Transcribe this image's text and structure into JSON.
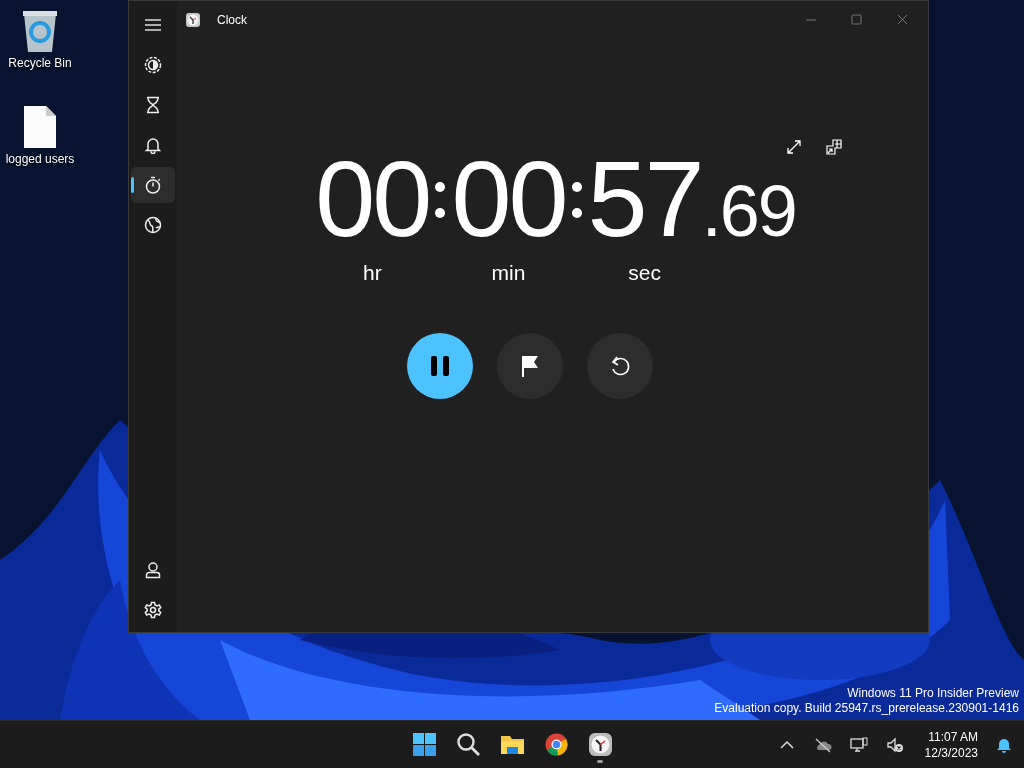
{
  "desktop_icons": [
    {
      "kind": "recycle",
      "label": "Recycle Bin"
    },
    {
      "kind": "file",
      "label": "logged users"
    }
  ],
  "window": {
    "title": "Clock"
  },
  "nav_items": [
    {
      "kind": "focus",
      "selected": false
    },
    {
      "kind": "timer",
      "selected": false
    },
    {
      "kind": "alarm",
      "selected": false
    },
    {
      "kind": "stopwatch",
      "selected": true
    },
    {
      "kind": "world",
      "selected": false
    }
  ],
  "nav_footer": [
    {
      "kind": "account"
    },
    {
      "kind": "settings"
    }
  ],
  "stopwatch": {
    "hours": "00",
    "minutes": "00",
    "seconds": "57",
    "fraction": ".69",
    "hours_label": "hr",
    "minutes_label": "min",
    "seconds_label": "sec",
    "running": true
  },
  "watermark": [
    "Windows 11 Pro Insider Preview",
    "Evaluation copy. Build 25947.rs_prerelease.230901-1416"
  ],
  "taskbar": {
    "apps": [
      {
        "kind": "start",
        "running": false
      },
      {
        "kind": "search",
        "running": false
      },
      {
        "kind": "explorer",
        "running": false
      },
      {
        "kind": "chrome",
        "running": false
      },
      {
        "kind": "clock",
        "running": true
      }
    ],
    "tray": [
      {
        "kind": "chevron"
      },
      {
        "kind": "cloud"
      },
      {
        "kind": "network"
      },
      {
        "kind": "volume"
      }
    ],
    "time": "11:07 AM",
    "date": "12/3/2023"
  }
}
